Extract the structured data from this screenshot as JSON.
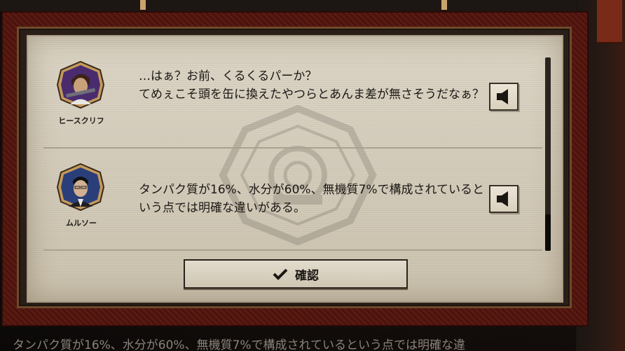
{
  "dialog": {
    "entries": [
      {
        "speaker": "ヒースクリフ",
        "text": "…はぁ？お前、くるくるパーか？\nてめぇこそ頭を缶に換えたやつらとあんま差が無さそうだなぁ？",
        "voice_icon": "speaker-icon",
        "portrait_colors": {
          "bg": "#4a2c6e",
          "hair": "#3a2418"
        }
      },
      {
        "speaker": "ムルソー",
        "text": "タンパク質が16%、水分が60%、無機質7%で構成されているという点では明確な違いがある。",
        "voice_icon": "speaker-icon",
        "portrait_colors": {
          "bg": "#2a3f7a",
          "hair": "#111111"
        }
      }
    ],
    "confirm_label": "確認",
    "confirm_icon": "checkmark-icon"
  },
  "subtitle": {
    "text": "タンパク質が16%、水分が60%、無機質7%で構成されているという点では明確な違"
  },
  "colors": {
    "frame": "#5a1a12",
    "paper": "#d6cfbf",
    "text": "#1a1714"
  }
}
